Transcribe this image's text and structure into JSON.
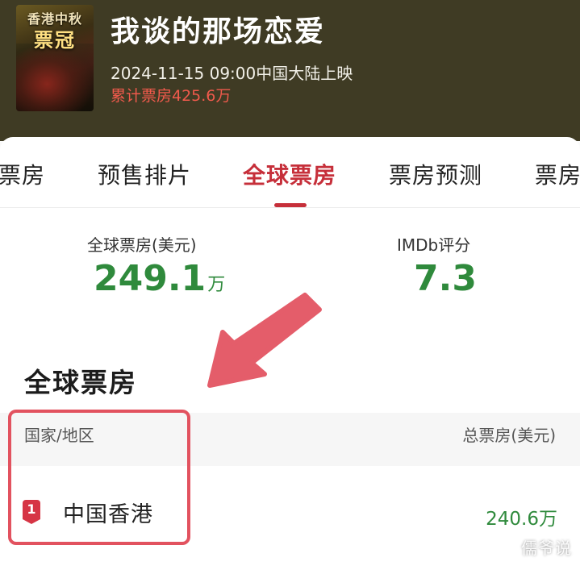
{
  "movie": {
    "poster": {
      "line1": "香港中秋",
      "line2": "票冠"
    },
    "title": "我谈的那场恋爱",
    "release": "2024-11-15 09:00中国大陆上映",
    "cumulative": "累计票房425.6万"
  },
  "tabs": [
    {
      "label": "票房",
      "active": false
    },
    {
      "label": "预售排片",
      "active": false
    },
    {
      "label": "全球票房",
      "active": true
    },
    {
      "label": "票房预测",
      "active": false
    },
    {
      "label": "票房",
      "active": false
    }
  ],
  "stats": {
    "global_label": "全球票房(美元)",
    "global_value": "249.1",
    "global_unit": "万",
    "imdb_label": "IMDb评分",
    "imdb_value": "7.3"
  },
  "section": {
    "title": "全球票房",
    "col_region": "国家/地区",
    "col_total": "总票房(美元)"
  },
  "rows": [
    {
      "rank": "1",
      "region": "中国香港",
      "value": "240.6万"
    }
  ],
  "watermark": "儒爷说",
  "colors": {
    "header_bg": "#3f3b24",
    "accent_red": "#c62f3a",
    "value_green": "#2f8a3c",
    "highlight": "#e2525f"
  }
}
